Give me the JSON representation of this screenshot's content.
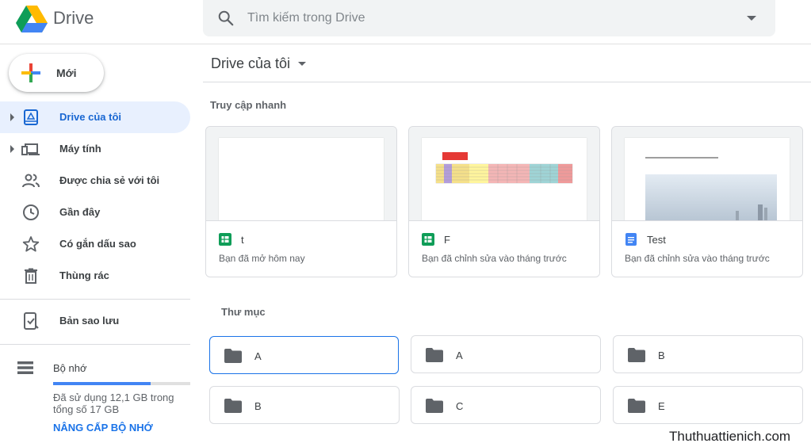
{
  "app": {
    "title": "Drive"
  },
  "search": {
    "placeholder": "Tìm kiếm trong Drive"
  },
  "new_button": {
    "label": "Mới"
  },
  "sidebar": {
    "items": [
      {
        "label": "Drive của tôi",
        "icon": "my-drive-icon",
        "active": true
      },
      {
        "label": "Máy tính",
        "icon": "computer-icon"
      },
      {
        "label": "Được chia sẻ với tôi",
        "icon": "shared-icon"
      },
      {
        "label": "Gần đây",
        "icon": "clock-icon"
      },
      {
        "label": "Có gắn dấu sao",
        "icon": "star-icon"
      },
      {
        "label": "Thùng rác",
        "icon": "trash-icon"
      },
      {
        "label": "Bản sao lưu",
        "icon": "backup-icon"
      }
    ],
    "storage": {
      "label": "Bộ nhớ",
      "used_text": "Đã sử dụng 12,1 GB trong tổng số 17 GB",
      "used_fraction": 0.71,
      "upgrade_label": "NÂNG CẤP BỘ NHỚ"
    }
  },
  "main": {
    "title": "Drive của tôi",
    "quick_access": {
      "title": "Truy cập nhanh",
      "files": [
        {
          "name": "t",
          "subtitle": "Bạn đã mở hôm nay",
          "type": "sheets"
        },
        {
          "name": "F",
          "subtitle": "Bạn đã chỉnh sửa vào tháng trước",
          "type": "sheets"
        },
        {
          "name": "Test",
          "subtitle": "Bạn đã chỉnh sửa vào tháng trước",
          "type": "docs"
        }
      ]
    },
    "folders": {
      "title": "Thư mục",
      "items": [
        "A",
        "A",
        "B",
        "B",
        "C",
        "E"
      ]
    }
  },
  "watermark": "Thuthuattienich.com",
  "colors": {
    "accent": "#1a73e8",
    "sheets": "#0f9d58",
    "docs": "#4285f4"
  }
}
